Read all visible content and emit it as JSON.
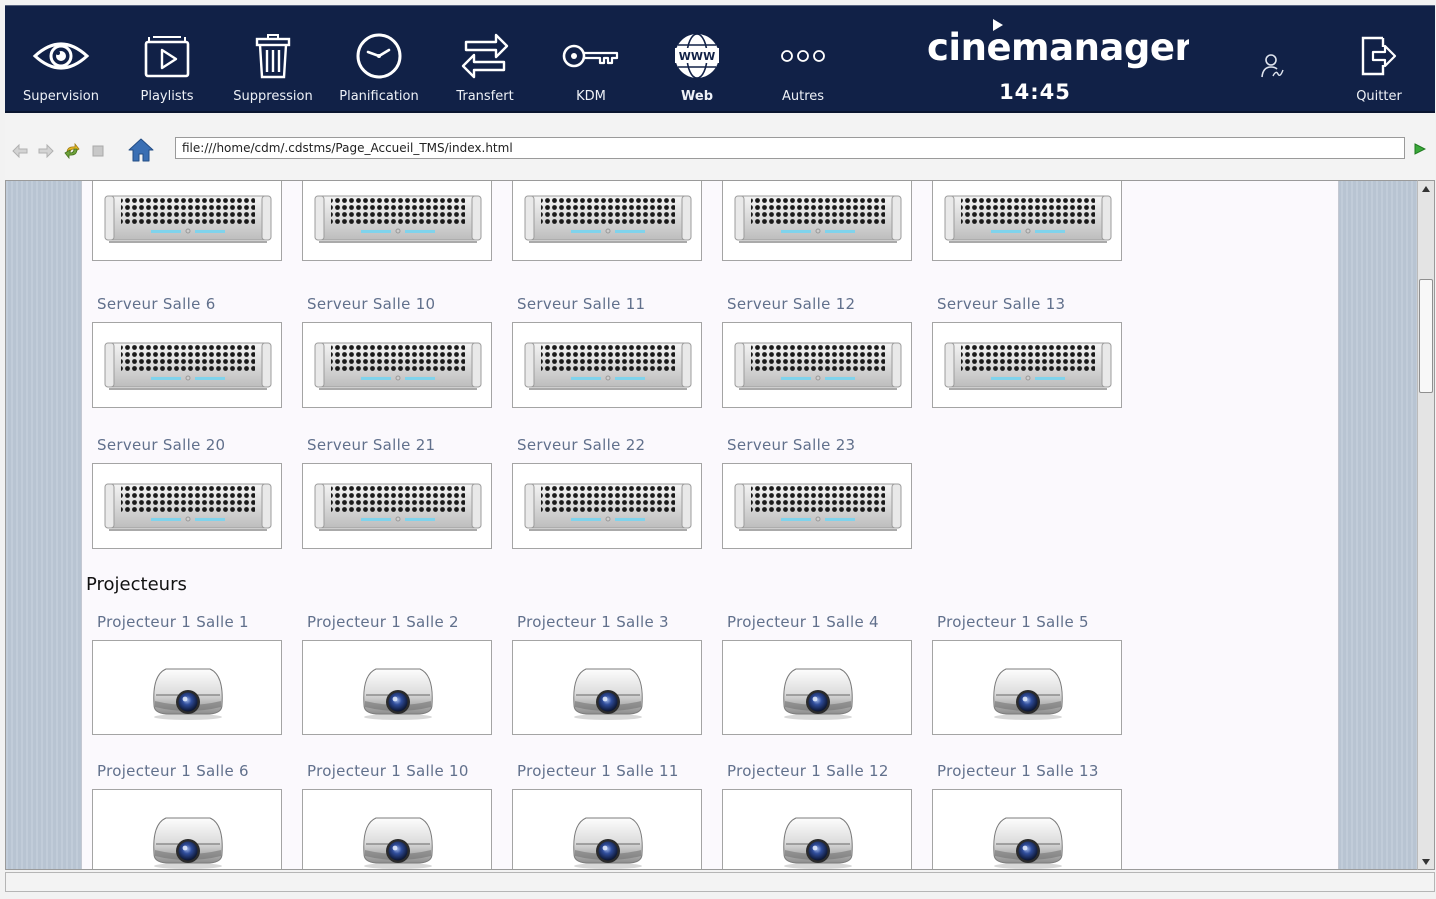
{
  "nav": {
    "items": [
      {
        "label": "Supervision",
        "icon": "eye-icon"
      },
      {
        "label": "Playlists",
        "icon": "playlist-icon"
      },
      {
        "label": "Suppression",
        "icon": "trash-icon"
      },
      {
        "label": "Planification",
        "icon": "clock-icon"
      },
      {
        "label": "Transfert",
        "icon": "transfer-arrows-icon"
      },
      {
        "label": "KDM",
        "icon": "key-icon"
      },
      {
        "label": "Web",
        "icon": "globe-www-icon",
        "active": true
      },
      {
        "label": "Autres",
        "icon": "more-dots-icon"
      }
    ],
    "quit_label": "Quitter",
    "brand": "cinemanager",
    "clock": "14:45"
  },
  "browser": {
    "url": "file:///home/cdm/.cdstms/Page_Accueil_TMS/index.html"
  },
  "servers": {
    "rows": [
      [
        "",
        "",
        "",
        "",
        ""
      ],
      [
        "Serveur Salle 6",
        "Serveur Salle 10",
        "Serveur Salle 11",
        "Serveur Salle 12",
        "Serveur Salle 13"
      ],
      [
        "Serveur Salle 20",
        "Serveur Salle 21",
        "Serveur Salle 22",
        "Serveur Salle 23"
      ]
    ]
  },
  "projectors": {
    "heading": "Projecteurs",
    "rows": [
      [
        "Projecteur 1 Salle 1",
        "Projecteur 1 Salle 2",
        "Projecteur 1 Salle 3",
        "Projecteur 1 Salle 4",
        "Projecteur 1 Salle 5"
      ],
      [
        "Projecteur 1 Salle 6",
        "Projecteur 1 Salle 10",
        "Projecteur 1 Salle 11",
        "Projecteur 1 Salle 12",
        "Projecteur 1 Salle 13"
      ]
    ]
  },
  "colors": {
    "topbar": "#112147",
    "tile_label": "#61708c",
    "page_background": "#fbf9fd",
    "side_background": "#bcc8d6"
  }
}
